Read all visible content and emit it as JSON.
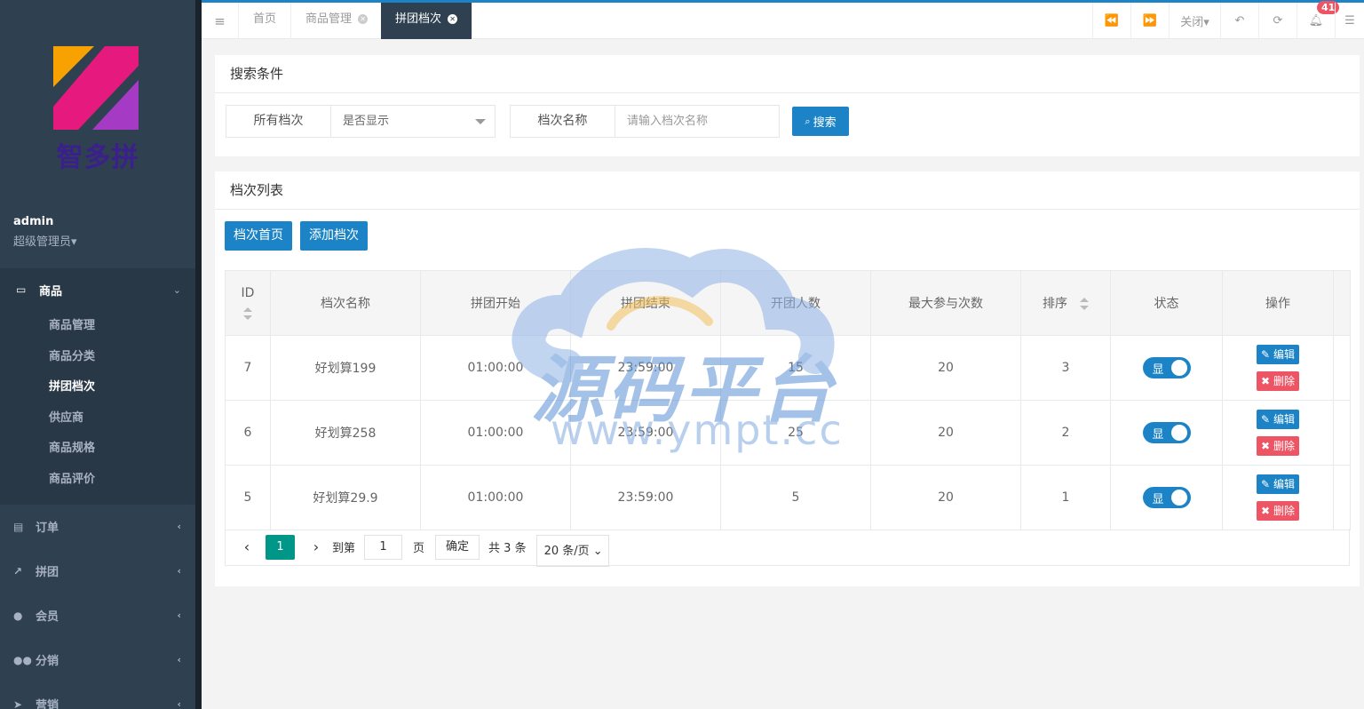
{
  "sidebar": {
    "logo_text": "智多拼",
    "user_name": "admin",
    "user_role": "超级管理员▾",
    "active_group": "商品",
    "sub_items": [
      "商品管理",
      "商品分类",
      "拼团档次",
      "供应商",
      "商品规格",
      "商品评价"
    ],
    "other_groups": [
      "订单",
      "拼团",
      "会员",
      "分销",
      "营销"
    ]
  },
  "tabs": {
    "items": [
      "首页",
      "商品管理",
      "拼团档次"
    ],
    "close_label": "关闭▾",
    "badge_count": "41"
  },
  "search": {
    "title": "搜索条件",
    "filter_label": "所有档次",
    "filter_value": "是否显示",
    "name_label": "档次名称",
    "name_placeholder": "请输入档次名称",
    "button": "搜索"
  },
  "list": {
    "title": "档次列表",
    "btn_home": "档次首页",
    "btn_add": "添加档次",
    "columns": [
      "ID",
      "档次名称",
      "拼团开始",
      "拼团结束",
      "开团人数",
      "最大参与次数",
      "排序",
      "状态",
      "操作"
    ],
    "rows": [
      {
        "id": "7",
        "name": "好划算199",
        "start": "01:00:00",
        "end": "23:59:00",
        "people": "15",
        "max": "20",
        "sort": "3",
        "status": "显"
      },
      {
        "id": "6",
        "name": "好划算258",
        "start": "01:00:00",
        "end": "23:59:00",
        "people": "25",
        "max": "20",
        "sort": "2",
        "status": "显"
      },
      {
        "id": "5",
        "name": "好划算29.9",
        "start": "01:00:00",
        "end": "23:59:00",
        "people": "5",
        "max": "20",
        "sort": "1",
        "status": "显"
      }
    ],
    "edit_label": "编辑",
    "delete_label": "删除"
  },
  "pager": {
    "current": "1",
    "goto_label": "到第",
    "goto_value": "1",
    "page_unit": "页",
    "confirm": "确定",
    "total": "共 3 条",
    "page_size": "20 条/页"
  },
  "watermark": {
    "cn": "源码平台",
    "url": "www.ympt.cc"
  },
  "colors": {
    "sidebar_bg": "#2f4050",
    "primary": "#1c84c6",
    "danger": "#ed5565",
    "pager_active": "#009688"
  }
}
